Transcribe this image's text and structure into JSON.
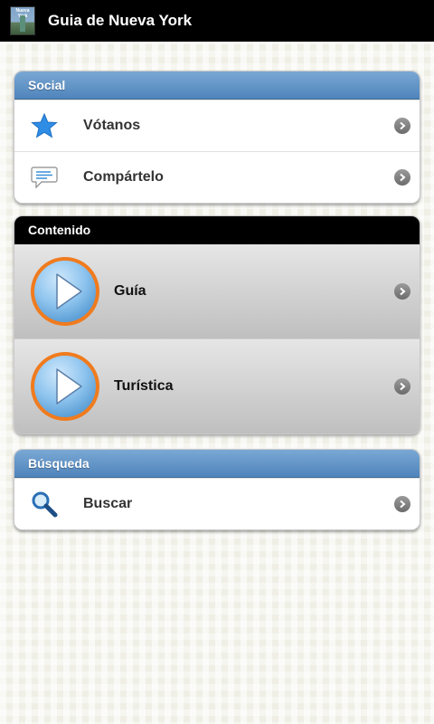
{
  "app": {
    "title": "Guia de Nueva York",
    "icon_caption": "Nueva York"
  },
  "social": {
    "header": "Social",
    "items": [
      {
        "label": "Vótanos",
        "icon": "star-icon"
      },
      {
        "label": "Compártelo",
        "icon": "chat-bubble-icon"
      }
    ]
  },
  "contenido": {
    "header": "Contenido",
    "items": [
      {
        "label": "Guía",
        "icon": "play-icon"
      },
      {
        "label": "Turística",
        "icon": "play-icon"
      }
    ]
  },
  "busqueda": {
    "header": "Búsqueda",
    "items": [
      {
        "label": "Buscar",
        "icon": "magnifier-icon"
      }
    ]
  },
  "colors": {
    "header_blue": "#4f84bb",
    "header_black": "#000000",
    "play_ring": "#f07b1e",
    "play_fill": "#8ec4ee"
  }
}
